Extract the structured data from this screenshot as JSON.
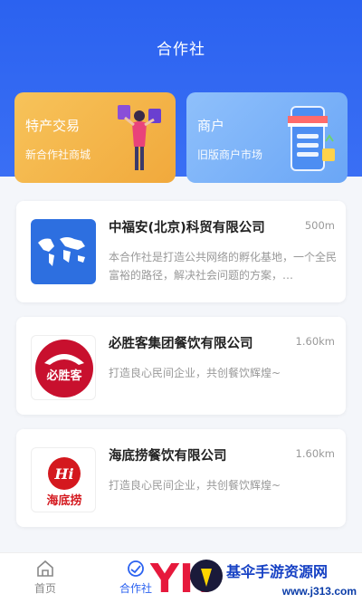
{
  "header": {
    "title": "合作社"
  },
  "banners": {
    "left": {
      "title": "特产交易",
      "subtitle": "新合作社商城",
      "color": "#f1a93c"
    },
    "right": {
      "title": "商户",
      "subtitle": "旧版商户市场",
      "color": "#6aa6f6"
    }
  },
  "list": [
    {
      "name": "中福安(北京)科贸有限公司",
      "distance": "500m",
      "description": "本合作社是打造公共网络的孵化基地，一个全民富裕的路径，解决社会问题的方案，…",
      "logo": "world-map-icon"
    },
    {
      "name": "必胜客集团餐饮有限公司",
      "distance": "1.60km",
      "description": "打造良心民间企业，共创餐饮辉煌~",
      "logo": "pizza-hut-logo",
      "logo_text": "必胜客"
    },
    {
      "name": "海底捞餐饮有限公司",
      "distance": "1.60km",
      "description": "打造良心民间企业，共创餐饮辉煌~",
      "logo": "haidilao-logo",
      "logo_text": "海底捞",
      "logo_mark": "Hi"
    }
  ],
  "tabbar": {
    "items": [
      {
        "label": "首页",
        "icon": "home-icon"
      },
      {
        "label": "合作社",
        "icon": "cooperative-icon",
        "active": true
      }
    ]
  },
  "watermark": {
    "text": "基伞手游资源网",
    "site": "www.j313.com"
  },
  "colors": {
    "primary": "#2b62f0",
    "background": "#f4f6fa"
  }
}
